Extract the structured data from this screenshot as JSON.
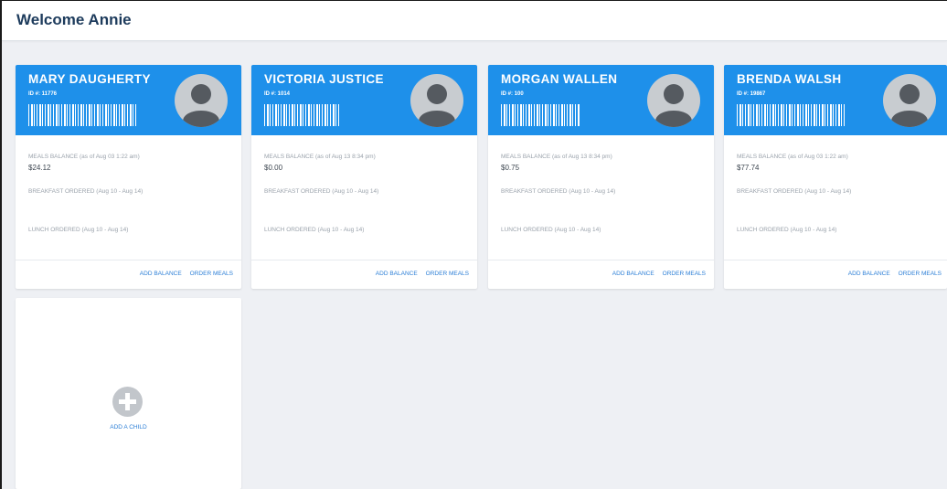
{
  "header": {
    "title": "Welcome Annie"
  },
  "children": [
    {
      "name": "MARY DAUGHERTY",
      "id_label": "ID #: 11776",
      "balance_label": "MEALS BALANCE (as of Aug 03 1:22 am)",
      "balance": "$24.12",
      "breakfast_label": "BREAKFAST ORDERED (Aug 10 - Aug 14)",
      "lunch_label": "LUNCH ORDERED (Aug 10 - Aug 14)",
      "add_balance": "ADD BALANCE",
      "order_meals": "ORDER MEALS"
    },
    {
      "name": "VICTORIA JUSTICE",
      "id_label": "ID #: 1014",
      "balance_label": "MEALS BALANCE (as of Aug 13 8:34 pm)",
      "balance": "$0.00",
      "breakfast_label": "BREAKFAST ORDERED (Aug 10 - Aug 14)",
      "lunch_label": "LUNCH ORDERED (Aug 10 - Aug 14)",
      "add_balance": "ADD BALANCE",
      "order_meals": "ORDER MEALS"
    },
    {
      "name": "MORGAN WALLEN",
      "id_label": "ID #: 100",
      "balance_label": "MEALS BALANCE (as of Aug 13 8:34 pm)",
      "balance": "$0.75",
      "breakfast_label": "BREAKFAST ORDERED (Aug 10 - Aug 14)",
      "lunch_label": "LUNCH ORDERED (Aug 10 - Aug 14)",
      "add_balance": "ADD BALANCE",
      "order_meals": "ORDER MEALS"
    },
    {
      "name": "BRENDA WALSH",
      "id_label": "ID #: 19867",
      "balance_label": "MEALS BALANCE (as of Aug 03 1:22 am)",
      "balance": "$77.74",
      "breakfast_label": "BREAKFAST ORDERED (Aug 10 - Aug 14)",
      "lunch_label": "LUNCH ORDERED (Aug 10 - Aug 14)",
      "add_balance": "ADD BALANCE",
      "order_meals": "ORDER MEALS"
    }
  ],
  "add_child": {
    "label": "ADD A CHILD",
    "icon": "plus-circle-icon"
  },
  "colors": {
    "header_blue": "#1e90ea",
    "link_blue": "#2b7ed6",
    "title_navy": "#1d3b5c",
    "page_bg": "#eef0f4"
  }
}
